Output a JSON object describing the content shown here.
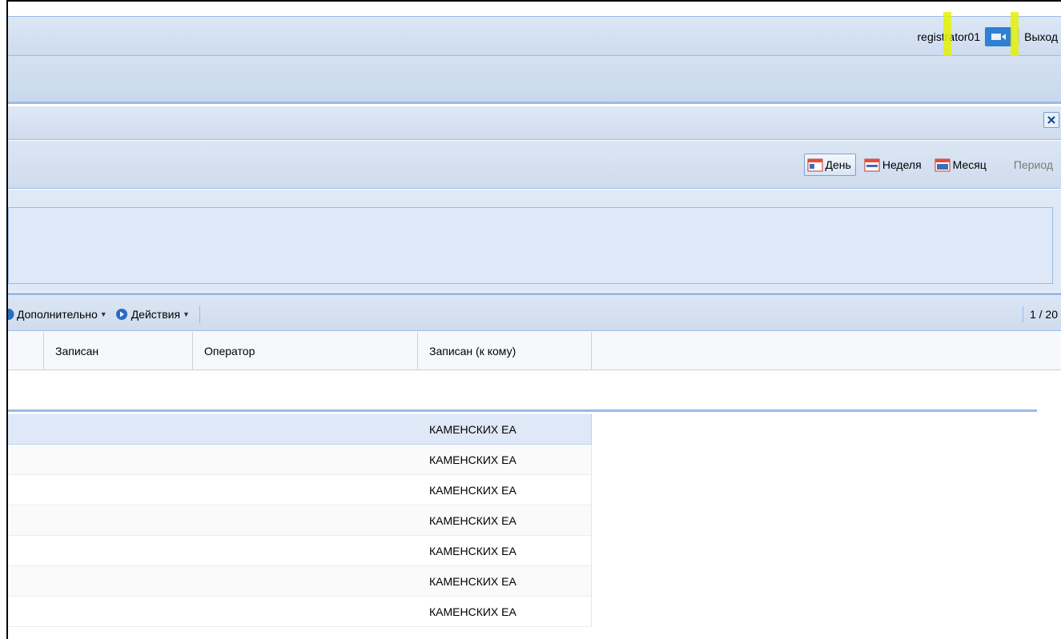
{
  "header": {
    "username": "registrator01",
    "logout_label": "Выход"
  },
  "period_toolbar": {
    "buttons": [
      {
        "label": "День",
        "active": true
      },
      {
        "label": "Неделя",
        "active": false
      },
      {
        "label": "Месяц",
        "active": false
      }
    ],
    "period_label": "Период"
  },
  "grid_toolbar": {
    "more_label": "Дополнительно",
    "actions_label": "Действия",
    "pager": "1 / 20"
  },
  "grid": {
    "columns": [
      "Записан",
      "Оператор",
      "Записан (к кому)"
    ],
    "rows": [
      "КАМЕНСКИХ ЕА",
      "КАМЕНСКИХ ЕА",
      "КАМЕНСКИХ ЕА",
      "КАМЕНСКИХ ЕА",
      "КАМЕНСКИХ ЕА",
      "КАМЕНСКИХ ЕА",
      "КАМЕНСКИХ ЕА"
    ]
  },
  "colors": {
    "accent": "#99bbe8",
    "video_button": "#2f7fd3",
    "highlight": "#e4f207"
  },
  "icons": [
    "video-camera-icon",
    "close-icon",
    "calendar-day-icon",
    "calendar-week-icon",
    "calendar-month-icon",
    "circle-arrow-icon"
  ]
}
